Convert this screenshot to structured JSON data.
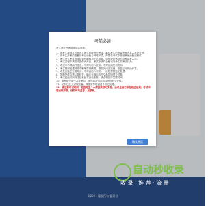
{
  "modal": {
    "title": "考前必读",
    "intro": "考生请在开考前阅读本条款：",
    "rules": [
      "1、请考生按规定时间进入考试系统进行考试，每位考生的登录账号为本人准考证号。",
      "2、请考生开考前准备好考试设备与网络环境，严禁在考试中使用其他设备或软件。",
      "3、考生进入考试系统后请仔细核对个人信息，如有疑问请及时联系监考人员。",
      "4、考试过程中请保持摄像头开启，考试系统将全程记录考生的考试行为。",
      "5、考试中不得离开座位，不得与他人交谈，不得查阅任何资料。",
      "6、考试期间如遇网络中断等异常情况，请勿关闭浏览器，恢复后可继续作答。",
      "7、考生应独立完成考试，不得由他人代考，一经发现按违纪处理。",
      "8、答题完成后请认真检查，确认无误后点击交卷按钮提交试卷。",
      "9、考试结束时间到达后系统将自动收卷，请合理安排答题时间。",
      "10、本系统仅用于本次考试，请勿将考试内容以任何形式外传。",
      "11、如有违反上述规定者，将视情节轻重给予相应处理。"
    ],
    "warning": "12、请注意考试时间，如因考生个人原因未按时交卷，由考生自行承担相应后果；考试中若出现异常，请及时与监考人员联系。",
    "confirm_label": "确认阅读"
  },
  "watermark": {
    "title": "自动秒收录",
    "subtitle": "收 录 · 推 荐 · 流 量"
  },
  "footer": {
    "text": "©2021 版权所有 备案号"
  },
  "colors": {
    "left_blue": "#2f5fa8",
    "button_blue": "#3f7fd6",
    "warning_red": "#d22b2b",
    "accent_orange": "#e7a34a",
    "watermark_green": "#7fbf4e"
  }
}
